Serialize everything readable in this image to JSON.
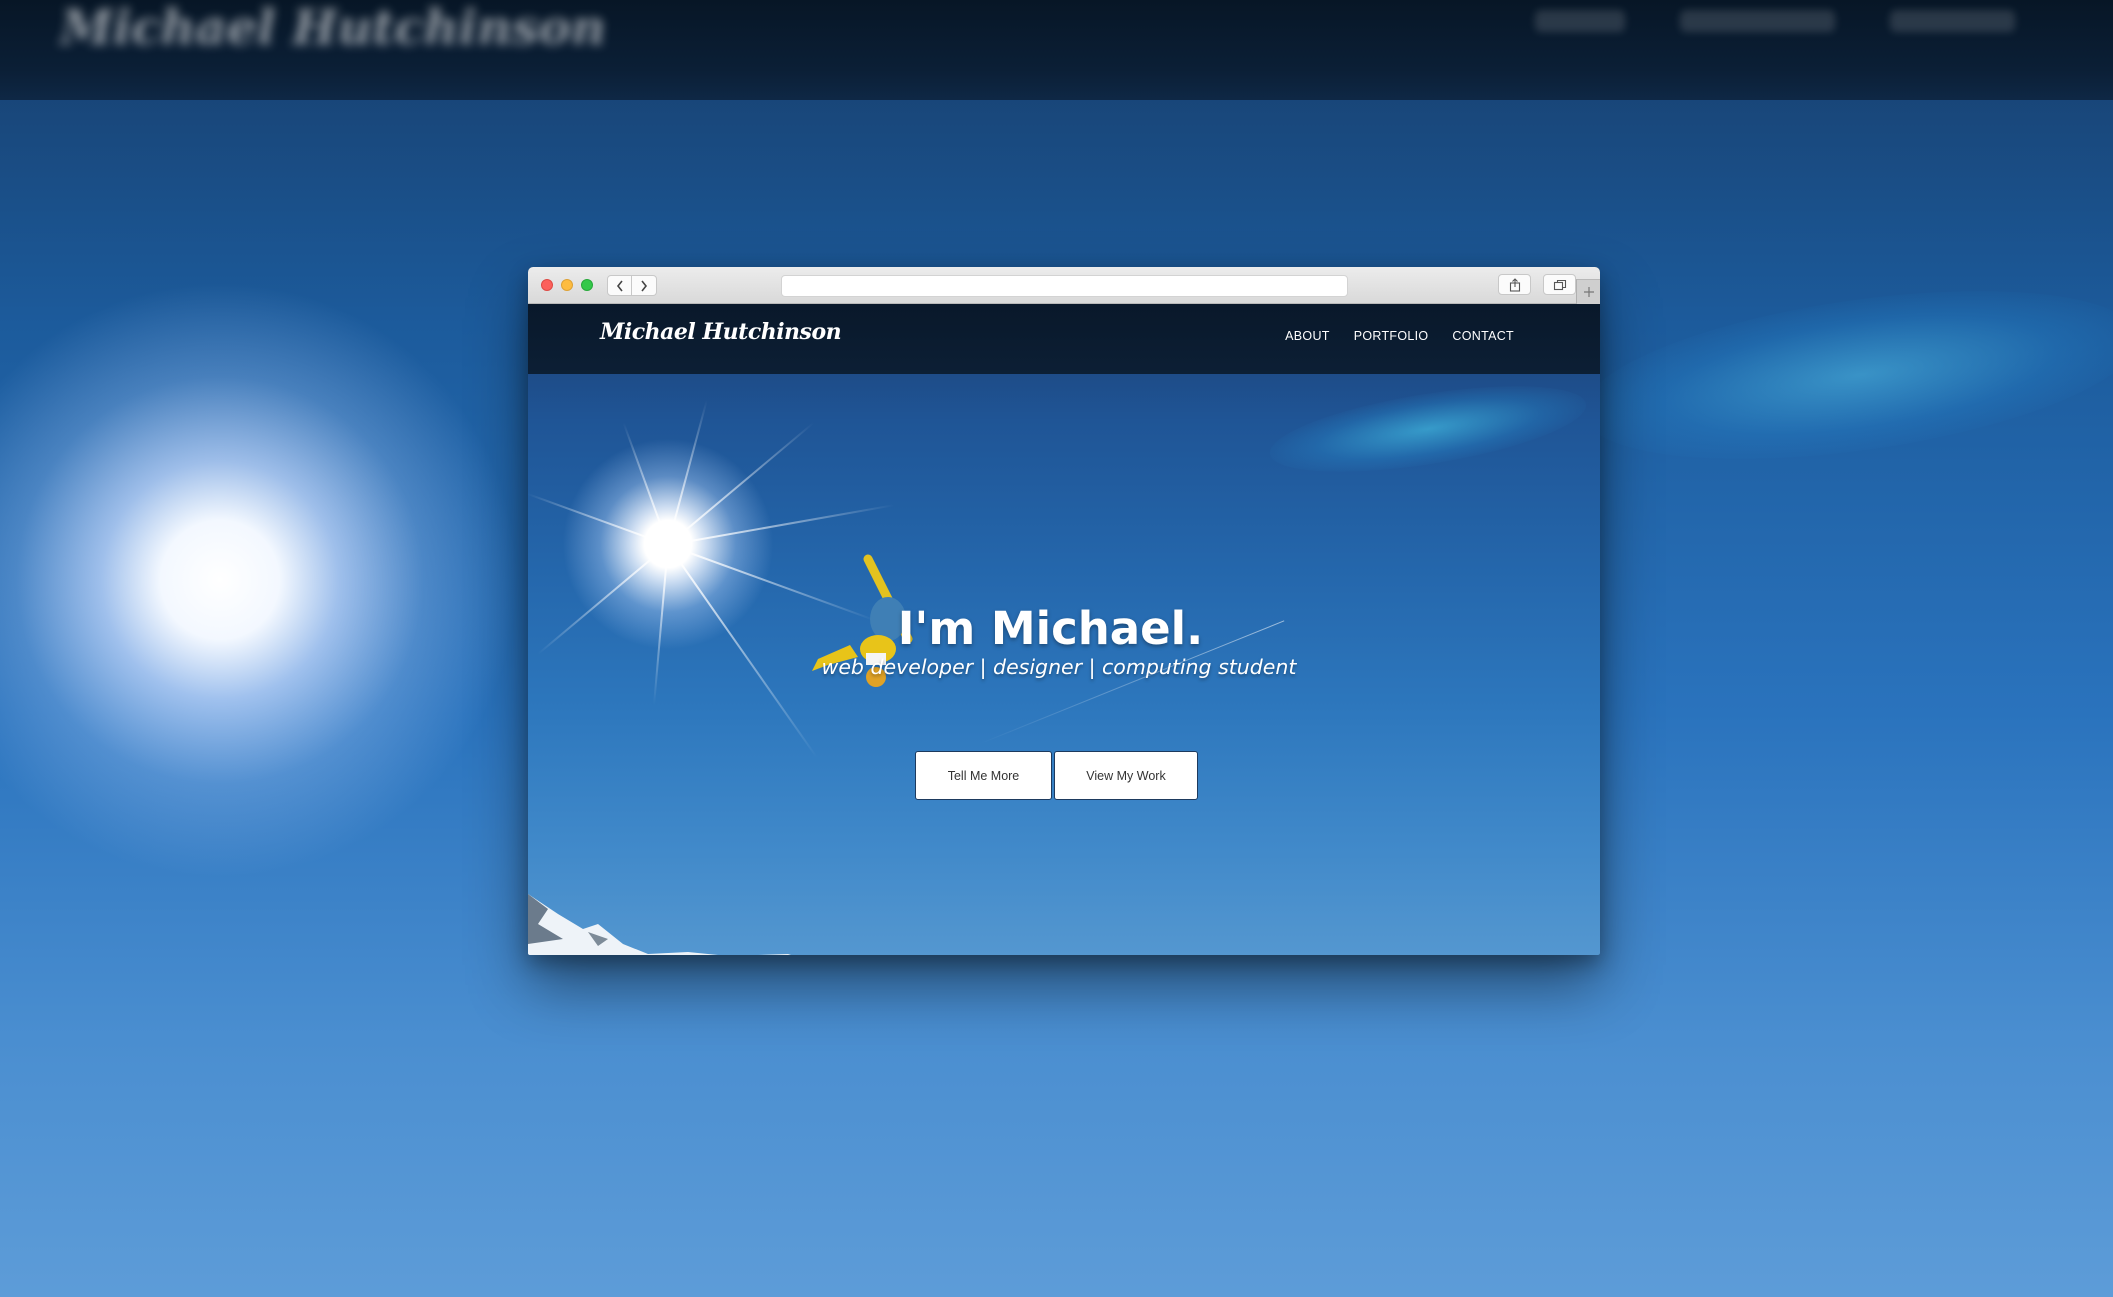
{
  "site": {
    "logo": "Michael Hutchinson",
    "nav": [
      {
        "label": "ABOUT"
      },
      {
        "label": "PORTFOLIO"
      },
      {
        "label": "CONTACT"
      }
    ],
    "hero": {
      "headline": "I'm Michael.",
      "subheadline": "web developer | designer | computing student",
      "buttons": [
        {
          "label": "Tell Me More"
        },
        {
          "label": "View My Work"
        }
      ]
    }
  },
  "browser": {
    "address": ""
  },
  "background_blur": {
    "logo": "Michael Hutchinson"
  },
  "icons": {
    "back": "chevron-left-icon",
    "forward": "chevron-right-icon",
    "share": "share-icon",
    "tabs": "tabs-icon",
    "new_tab": "plus-icon"
  },
  "colors": {
    "nav_background": "#0c1f35",
    "sky": "#2466ab",
    "button_bg": "#ffffff",
    "close": "#fc605b",
    "minimize": "#fdbc40",
    "maximize": "#34c84a"
  }
}
